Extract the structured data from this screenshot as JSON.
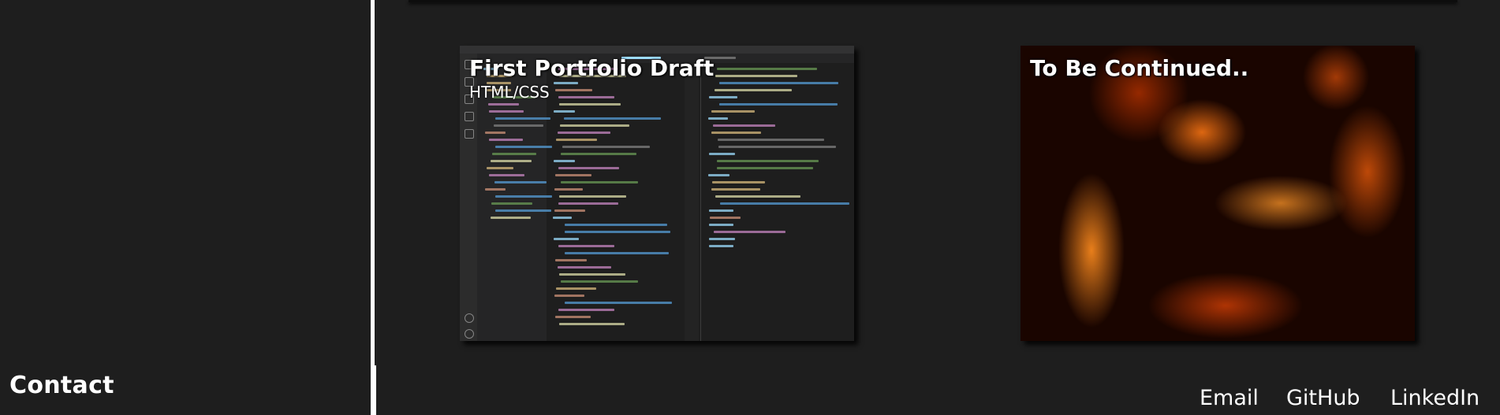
{
  "sidebar": {
    "contact_heading": "Contact"
  },
  "projects": [
    {
      "title": "First Portfolio Draft",
      "subtitle": "HTML/CSS",
      "image": "code-editor-screenshot"
    },
    {
      "title": "To Be Continued..",
      "subtitle": "",
      "image": "fire-flames"
    }
  ],
  "footer": {
    "links": [
      {
        "label": "Email"
      },
      {
        "label": "GitHub"
      },
      {
        "label": "LinkedIn"
      }
    ]
  },
  "colors": {
    "background": "#1e1e1e",
    "text": "#ffffff",
    "divider": "#ffffff"
  }
}
